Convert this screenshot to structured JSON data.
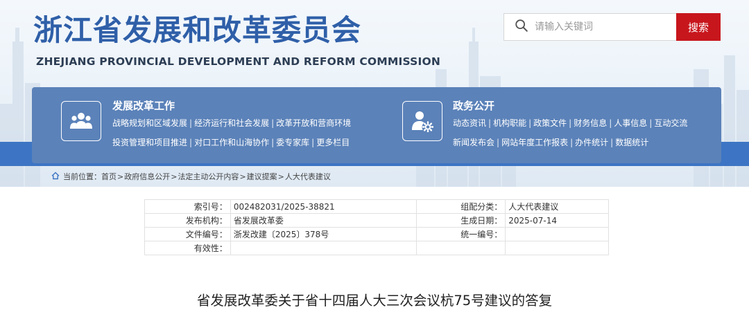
{
  "header": {
    "logo_cn": "浙江省发展和改革委员会",
    "logo_en": "ZHEJIANG PROVINCIAL DEVELOPMENT AND REFORM COMMISSION"
  },
  "search": {
    "placeholder": "请输入关键词",
    "button_label": "搜索",
    "icon": "search-icon"
  },
  "nav": {
    "left": {
      "title": "发展改革工作",
      "icon": "people-group-icon",
      "lines": [
        [
          "战略规划和区域发展",
          "经济运行和社会发展",
          "改革开放和营商环境"
        ],
        [
          "投资管理和项目推进",
          "对口工作和山海协作",
          "委专家库",
          "更多栏目"
        ]
      ]
    },
    "right": {
      "title": "政务公开",
      "icon": "user-gear-icon",
      "lines": [
        [
          "动态资讯",
          "机构职能",
          "政策文件",
          "财务信息",
          "人事信息",
          "互动交流"
        ],
        [
          "新闻发布会",
          "网站年度工作报表",
          "办件统计",
          "数据统计"
        ]
      ]
    }
  },
  "breadcrumb": {
    "icon": "home-icon",
    "prefix": "当前位置：",
    "items": [
      "首页",
      "政府信息公开",
      "法定主动公开内容",
      "建议提案",
      "人大代表建议"
    ],
    "separator": ">"
  },
  "meta": {
    "rows": [
      {
        "label1": "索引号：",
        "value1": "002482031/2025-38821",
        "label2": "组配分类：",
        "value2": "人大代表建议"
      },
      {
        "label1": "发布机构：",
        "value1": "省发展改革委",
        "label2": "生成日期：",
        "value2": "2025-07-14"
      },
      {
        "label1": "文件编号：",
        "value1": "浙发改建〔2025〕378号",
        "label2": "统一编号：",
        "value2": ""
      },
      {
        "label1": "有效性：",
        "value1": "",
        "label2": "",
        "value2": ""
      }
    ]
  },
  "document": {
    "title": "省发展改革委关于省十四届人大三次会议杭75号建议的答复"
  },
  "colors": {
    "brand_blue": "#2f5fa8",
    "nav_panel": "#5b82b9",
    "stripe": "#3d75c4",
    "search_red": "#c8161d"
  }
}
